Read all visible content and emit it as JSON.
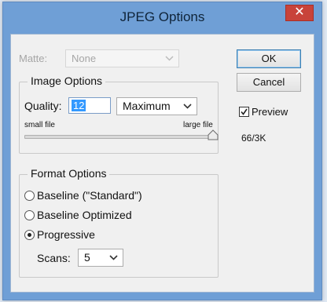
{
  "dialog": {
    "title": "JPEG Options",
    "close_glyph": "✕"
  },
  "matte": {
    "label": "Matte:",
    "value": "None"
  },
  "buttons": {
    "ok": "OK",
    "cancel": "Cancel"
  },
  "preview": {
    "label": "Preview",
    "checked": true
  },
  "size_readout": "66/3K",
  "image_options": {
    "legend": "Image Options",
    "quality_label": "Quality:",
    "quality_value": "12",
    "quality_preset": "Maximum",
    "slider_min_label": "small file",
    "slider_max_label": "large file",
    "slider_level": 1.0
  },
  "format_options": {
    "legend": "Format Options",
    "options": [
      "Baseline (\"Standard\")",
      "Baseline Optimized",
      "Progressive"
    ],
    "selected_index": 2,
    "scans_label": "Scans:",
    "scans_value": "5"
  },
  "colors": {
    "titlebar": "#6f9fd6",
    "close": "#c8433a",
    "selection": "#3399ff"
  },
  "icons": [
    "close-icon",
    "chevron-down-icon",
    "checkmark-icon",
    "slider-thumb"
  ]
}
